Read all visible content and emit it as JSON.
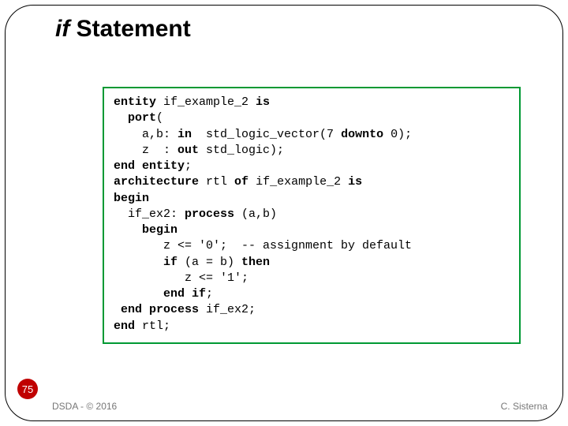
{
  "title": {
    "italic": "if",
    "rest": " Statement"
  },
  "code": {
    "l1a": "entity",
    "l1b": " if_example_2 ",
    "l1c": "is",
    "l2a": "  port",
    "l2b": "(",
    "l3a": "    a,b: ",
    "l3b": "in",
    "l3c": "  std_logic_vector(7 ",
    "l3d": "downto",
    "l3e": " 0);",
    "l4a": "    z  : ",
    "l4b": "out",
    "l4c": " std_logic);",
    "l5a": "end entity",
    "l5b": ";",
    "l6a": "architecture",
    "l6b": " rtl ",
    "l6c": "of",
    "l6d": " if_example_2 ",
    "l6e": "is",
    "l7": "begin",
    "l8a": "  if_ex2: ",
    "l8b": "process",
    "l8c": " (a,b)",
    "l9a": "    ",
    "l9b": "begin",
    "l10": "       z <= '0';  -- assignment by default",
    "l11a": "       ",
    "l11b": "if",
    "l11c": " (a = b) ",
    "l11d": "then",
    "l12": "          z <= '1';",
    "l13a": "       ",
    "l13b": "end if",
    "l13c": ";",
    "l14a": " ",
    "l14b": "end process",
    "l14c": " if_ex2;",
    "l15a": "end",
    "l15b": " rtl;"
  },
  "slide_number": "75",
  "footer_left": "DSDA - © 2016",
  "footer_right": "C. Sisterna"
}
